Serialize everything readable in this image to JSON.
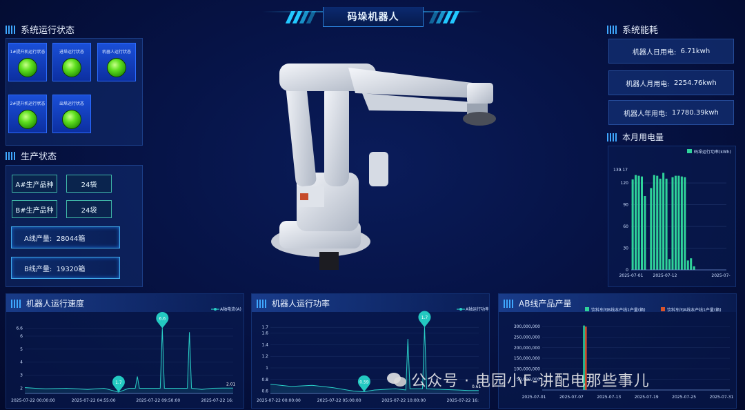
{
  "header": {
    "title": "码垛机器人"
  },
  "system_status": {
    "title": "系统运行状态",
    "cards": [
      {
        "label": "1#提升机运行状态"
      },
      {
        "label": "进垛运行状态"
      },
      {
        "label": "机器人运行状态"
      },
      {
        "label": "2#提升机运行状态"
      },
      {
        "label": "出垛运行状态"
      }
    ]
  },
  "production": {
    "title": "生产状态",
    "products": [
      {
        "name": "A#生产品种",
        "value": "24袋"
      },
      {
        "name": "B#生产品种",
        "value": "24袋"
      }
    ],
    "outputs": [
      {
        "label": "A线产量:",
        "value": "28044箱"
      },
      {
        "label": "B线产量:",
        "value": "19320箱"
      }
    ]
  },
  "energy": {
    "title": "系统能耗",
    "items": [
      {
        "label": "机器人日用电:",
        "value": "6.71kwh"
      },
      {
        "label": "机器人月用电:",
        "value": "2254.76kwh"
      },
      {
        "label": "机器人年用电:",
        "value": "17780.39kwh"
      }
    ]
  },
  "monthly": {
    "title": "本月用电量",
    "legend": "码垛运行功率(kWh)",
    "colors": {
      "bar": "#2fd39a"
    }
  },
  "speed": {
    "title": "机器人运行速度",
    "legend": "A轴电流(A)"
  },
  "power": {
    "title": "机器人运行功率",
    "legend": "A轴运行功率(kW)"
  },
  "output": {
    "title": "AB线产品产量",
    "legend": [
      "饮料车间B线本产线1产量(箱)",
      "饮料车间A线本产线1产量(箱)"
    ],
    "colors": {
      "b": "#2fd39a",
      "a": "#d9532a"
    }
  },
  "watermark": {
    "text": "公众号 · 电园小F-讲配电那些事儿"
  },
  "chart_data": [
    {
      "type": "bar",
      "title": "本月用电量",
      "series": [
        {
          "name": "码垛运行功率(kWh)",
          "values": [
            125,
            131,
            130,
            129,
            102,
            0,
            113,
            131,
            130,
            126,
            134,
            126,
            15,
            128,
            130,
            130,
            129,
            128,
            13,
            16,
            5,
            0,
            0,
            0,
            0,
            0,
            0,
            0,
            0,
            0,
            0
          ]
        }
      ],
      "x": [
        "2025-07-01",
        "2025-07-02",
        "2025-07-03",
        "2025-07-04",
        "2025-07-05",
        "2025-07-06",
        "2025-07-07",
        "2025-07-08",
        "2025-07-09",
        "2025-07-10",
        "2025-07-11",
        "2025-07-12",
        "2025-07-13",
        "2025-07-14",
        "2025-07-15",
        "2025-07-16",
        "2025-07-17",
        "2025-07-18",
        "2025-07-19",
        "2025-07-20",
        "2025-07-21",
        "2025-07-22",
        "2025-07-23",
        "2025-07-24",
        "2025-07-25",
        "2025-07-26",
        "2025-07-27",
        "2025-07-28",
        "2025-07-29",
        "2025-07-30",
        "2025-07-31"
      ],
      "xticks": [
        "2025-07-01",
        "2025-07-12",
        "2025-07-"
      ],
      "yticks": [
        0,
        30,
        60,
        90,
        120
      ],
      "ymax_label": "139.17",
      "ylim": [
        0,
        139.17
      ]
    },
    {
      "type": "line",
      "title": "机器人运行速度",
      "series": [
        {
          "name": "A轴电流(A)",
          "points": [
            [
              0,
              2.05
            ],
            [
              0.05,
              2.0
            ],
            [
              0.1,
              1.95
            ],
            [
              0.2,
              2.0
            ],
            [
              0.3,
              1.9
            ],
            [
              0.38,
              2.0
            ],
            [
              0.45,
              1.7
            ],
            [
              0.5,
              2.0
            ],
            [
              0.53,
              2.0
            ],
            [
              0.54,
              2.9
            ],
            [
              0.55,
              2.0
            ],
            [
              0.65,
              2.0
            ],
            [
              0.66,
              6.6
            ],
            [
              0.67,
              2.0
            ],
            [
              0.78,
              2.0
            ],
            [
              0.79,
              6.3
            ],
            [
              0.8,
              2.0
            ],
            [
              0.85,
              1.9
            ],
            [
              0.9,
              2.0
            ],
            [
              0.95,
              2.01
            ],
            [
              1.0,
              2.01
            ]
          ]
        }
      ],
      "markers": [
        {
          "label": "1.7"
        },
        {
          "label": "6.6"
        },
        {
          "label": "2.01"
        }
      ],
      "xticks": [
        "2025-07-22 00:00:00",
        "2025-07-22 04:55:00",
        "2025-07-22 09:50:00",
        "2025-07-22 16:"
      ],
      "yticks": [
        2,
        3,
        4,
        5,
        6,
        "6.6"
      ],
      "ylim": [
        1.6,
        6.9
      ]
    },
    {
      "type": "line",
      "title": "机器人运行功率",
      "series": [
        {
          "name": "A轴运行功率(kW)",
          "points": [
            [
              0,
              0.72
            ],
            [
              0.05,
              0.7
            ],
            [
              0.1,
              0.68
            ],
            [
              0.2,
              0.7
            ],
            [
              0.3,
              0.66
            ],
            [
              0.4,
              0.6
            ],
            [
              0.45,
              0.59
            ],
            [
              0.5,
              0.62
            ],
            [
              0.6,
              0.64
            ],
            [
              0.65,
              0.62
            ],
            [
              0.66,
              1.5
            ],
            [
              0.67,
              0.64
            ],
            [
              0.73,
              0.64
            ],
            [
              0.74,
              1.7
            ],
            [
              0.75,
              0.64
            ],
            [
              0.82,
              0.63
            ],
            [
              0.9,
              0.62
            ],
            [
              0.95,
              0.61
            ],
            [
              1.0,
              0.61
            ]
          ]
        }
      ],
      "markers": [
        {
          "label": "0.59"
        },
        {
          "label": "1.7"
        },
        {
          "label": "0.61"
        }
      ],
      "xticks": [
        "2025-07-22 00:00:00",
        "2025-07-22 05:00:00",
        "2025-07-22 10:00:00",
        "2025-07-22 16:"
      ],
      "yticks": [
        0.6,
        0.8,
        1,
        1.2,
        1.4,
        1.6,
        1.7
      ],
      "ylim": [
        0.56,
        1.75
      ]
    },
    {
      "type": "bar",
      "title": "AB线产品产量",
      "series": [
        {
          "name": "饮料车间B线本产线1产量(箱)",
          "values": [
            305000000
          ]
        },
        {
          "name": "饮料车间A线本产线1产量(箱)",
          "values": [
            300000000
          ]
        }
      ],
      "xticks": [
        "2025-07-01",
        "2025-07-07",
        "2025-07-13",
        "2025-07-19",
        "2025-07-25",
        "2025-07-31"
      ],
      "yticks": [
        "50,000,000",
        "100,000,000",
        "150,000,000",
        "200,000,000",
        "250,000,000",
        "300,000,000"
      ],
      "ylim": [
        0,
        320000000
      ]
    }
  ]
}
